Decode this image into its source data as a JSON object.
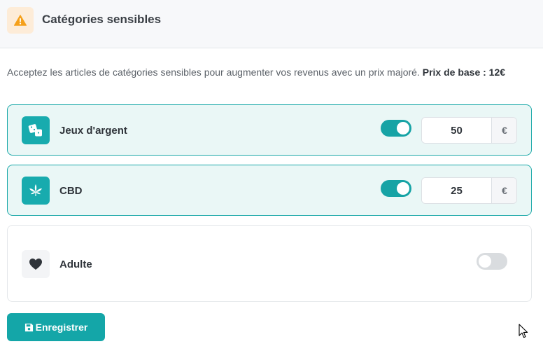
{
  "header": {
    "icon": "warning-icon",
    "title": "Catégories sensibles"
  },
  "description": {
    "text": "Acceptez les articles de catégories sensibles pour augmenter vos revenus avec un prix majoré. ",
    "base_price_label": "Prix de base : 12€"
  },
  "categories": [
    {
      "label": "Jeux d'argent",
      "icon": "dice-icon",
      "enabled": true,
      "price": "50",
      "currency": "€"
    },
    {
      "label": "CBD",
      "icon": "cannabis-leaf-icon",
      "enabled": true,
      "price": "25",
      "currency": "€"
    },
    {
      "label": "Adulte",
      "icon": "heart-icon",
      "enabled": false
    }
  ],
  "save_button": {
    "icon": "floppy-disk-icon",
    "label": "Enregistrer"
  },
  "colors": {
    "accent": "#16a3a5",
    "warning": "#f5a623",
    "enabled_card_bg": "#eaf7f6"
  }
}
